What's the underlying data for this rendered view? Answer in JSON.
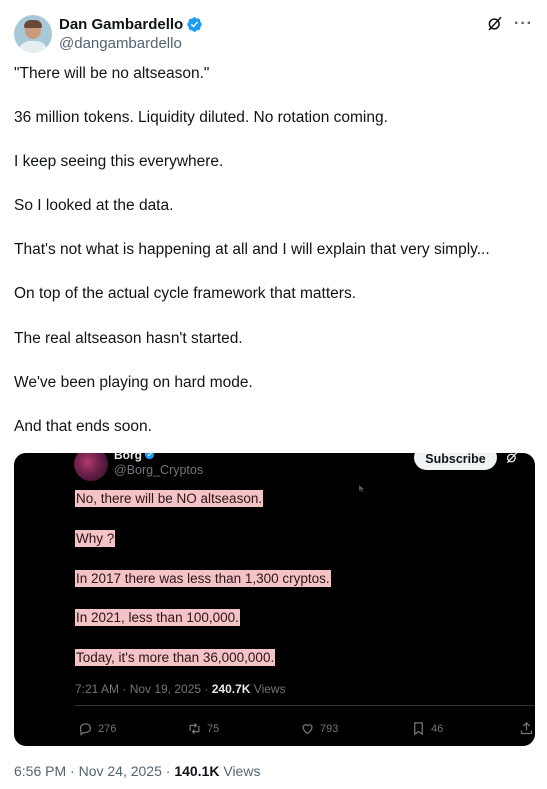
{
  "author": {
    "display_name": "Dan Gambardello",
    "handle": "@dangambardello"
  },
  "tweet": {
    "paragraphs": [
      "\"There will be no altseason.\"",
      "36 million tokens. Liquidity diluted. No rotation coming.",
      "I keep seeing this everywhere.",
      "So I looked at the data.",
      "That's not what is happening at all and I will explain that very simply...",
      "On top of the actual cycle framework that matters.",
      "The real altseason hasn't started.",
      "We've been playing on hard mode.",
      "And that ends soon."
    ],
    "time": "6:56 PM · Nov 24, 2025 · ",
    "views_count": "140.1K",
    "views_label": " Views"
  },
  "quoted": {
    "display_name": "Borg",
    "handle": "@Borg_Cryptos",
    "subscribe_label": "Subscribe",
    "lines": [
      "No, there will be NO altseason.",
      "Why ?",
      "In 2017 there was less than 1,300 cryptos.",
      "In 2021, less than 100,000.",
      "Today, it's more than 36,000,000."
    ],
    "meta_time": "7:21 AM · Nov 19, 2025 · ",
    "meta_views": "240.7K",
    "meta_views_label": " Views",
    "replies": "276",
    "reposts": "75",
    "likes": "793",
    "bookmarks": "46"
  },
  "colors": {
    "verified": "#1d9bf0",
    "highlight": "#f4c3c6",
    "media_bg": "#000000"
  },
  "icons": [
    "verified-badge-icon",
    "grok-icon",
    "more-icon",
    "reply-icon",
    "repost-icon",
    "like-icon",
    "bookmark-icon",
    "share-icon"
  ]
}
